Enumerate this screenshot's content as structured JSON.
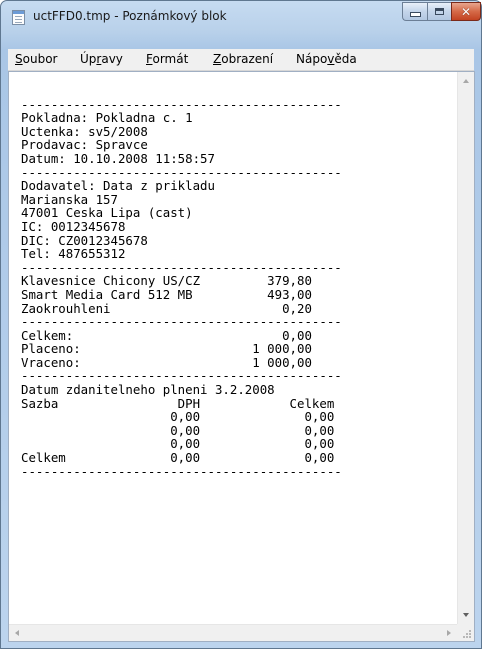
{
  "window": {
    "title": "uctFFD0.tmp - Poznámkový blok",
    "icon": "notepad-icon",
    "buttons": {
      "minimize": "minimize-icon",
      "maximize": "maximize-icon",
      "close": "close-icon",
      "close_glyph": "✕"
    }
  },
  "menu": [
    {
      "label": "Soubor",
      "mnemonic": "S"
    },
    {
      "label": "Úpravy",
      "mnemonic": "r"
    },
    {
      "label": "Formát",
      "mnemonic": "F"
    },
    {
      "label": "Zobrazení",
      "mnemonic": "Z"
    },
    {
      "label": "Nápověda",
      "mnemonic": "v"
    }
  ],
  "document": {
    "lines": [
      "",
      "-------------------------------------------",
      "Pokladna: Pokladna c. 1",
      "Uctenka: sv5/2008",
      "Prodavac: Spravce",
      "Datum: 10.10.2008 11:58:57",
      "-------------------------------------------",
      "Dodavatel: Data z prikladu",
      "Marianska 157",
      "47001 Ceska Lipa (cast)",
      "IC: 0012345678",
      "DIC: CZ0012345678",
      "Tel: 487655312",
      "-------------------------------------------",
      "Klavesnice Chicony US/CZ         379,80",
      "Smart Media Card 512 MB          493,00",
      "Zaokrouhleni                       0,20",
      "-------------------------------------------",
      "Celkem:                            0,00",
      "Placeno:                       1 000,00",
      "Vraceno:                       1 000,00",
      "-------------------------------------------",
      "Datum zdanitelneho plneni 3.2.2008",
      "Sazba                DPH            Celkem",
      "                    0,00              0,00",
      "                    0,00              0,00",
      "                    0,00              0,00",
      "Celkem              0,00              0,00",
      "-------------------------------------------"
    ]
  },
  "scrollbars": {
    "vertical": [
      "scroll-up-arrow-icon",
      "scroll-down-arrow-icon"
    ],
    "horizontal": [
      "scroll-left-arrow-icon",
      "scroll-right-arrow-icon"
    ],
    "grip": "resize-grip-icon"
  }
}
